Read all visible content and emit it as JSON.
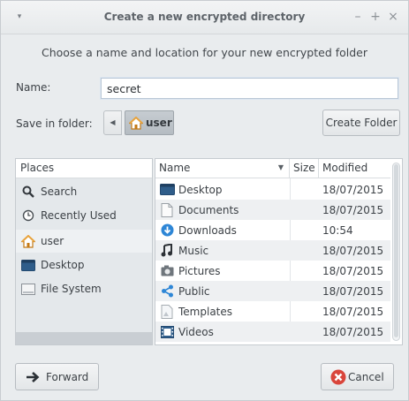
{
  "window": {
    "title": "Create a new encrypted directory",
    "menu_icon": "▾",
    "minimize": "–",
    "maximize": "+",
    "close": "×"
  },
  "subtitle": "Choose a name and location for your new encrypted folder",
  "name_field": {
    "label": "Name:",
    "value": "secret"
  },
  "save_in": {
    "label": "Save in folder:",
    "back_arrow": "◀",
    "current": "user",
    "create_folder_label": "Create Folder"
  },
  "places": {
    "header": "Places",
    "items": [
      {
        "label": "Search",
        "icon": "search-icon"
      },
      {
        "label": "Recently Used",
        "icon": "clock-icon"
      },
      {
        "label": "user",
        "icon": "home-icon",
        "selected": true
      },
      {
        "label": "Desktop",
        "icon": "desktop-icon"
      },
      {
        "label": "File System",
        "icon": "drive-icon"
      }
    ]
  },
  "files": {
    "headers": {
      "name": "Name",
      "sort_arrow": "▼",
      "size": "Size",
      "modified": "Modified"
    },
    "rows": [
      {
        "name": "Desktop",
        "modified": "18/07/2015",
        "icon": "desktop-folder-icon"
      },
      {
        "name": "Documents",
        "modified": "18/07/2015",
        "icon": "document-folder-icon"
      },
      {
        "name": "Downloads",
        "modified": "10:54",
        "icon": "download-folder-icon"
      },
      {
        "name": "Music",
        "modified": "18/07/2015",
        "icon": "music-folder-icon"
      },
      {
        "name": "Pictures",
        "modified": "18/07/2015",
        "icon": "pictures-folder-icon"
      },
      {
        "name": "Public",
        "modified": "18/07/2015",
        "icon": "public-folder-icon"
      },
      {
        "name": "Templates",
        "modified": "18/07/2015",
        "icon": "templates-folder-icon"
      },
      {
        "name": "Videos",
        "modified": "18/07/2015",
        "icon": "videos-folder-icon"
      }
    ]
  },
  "footer": {
    "forward_label": "Forward",
    "cancel_label": "Cancel"
  },
  "colors": {
    "accent_home": "#e8a33c",
    "cancel_red": "#d9453b",
    "folder_blue": "#2f5d8a"
  }
}
